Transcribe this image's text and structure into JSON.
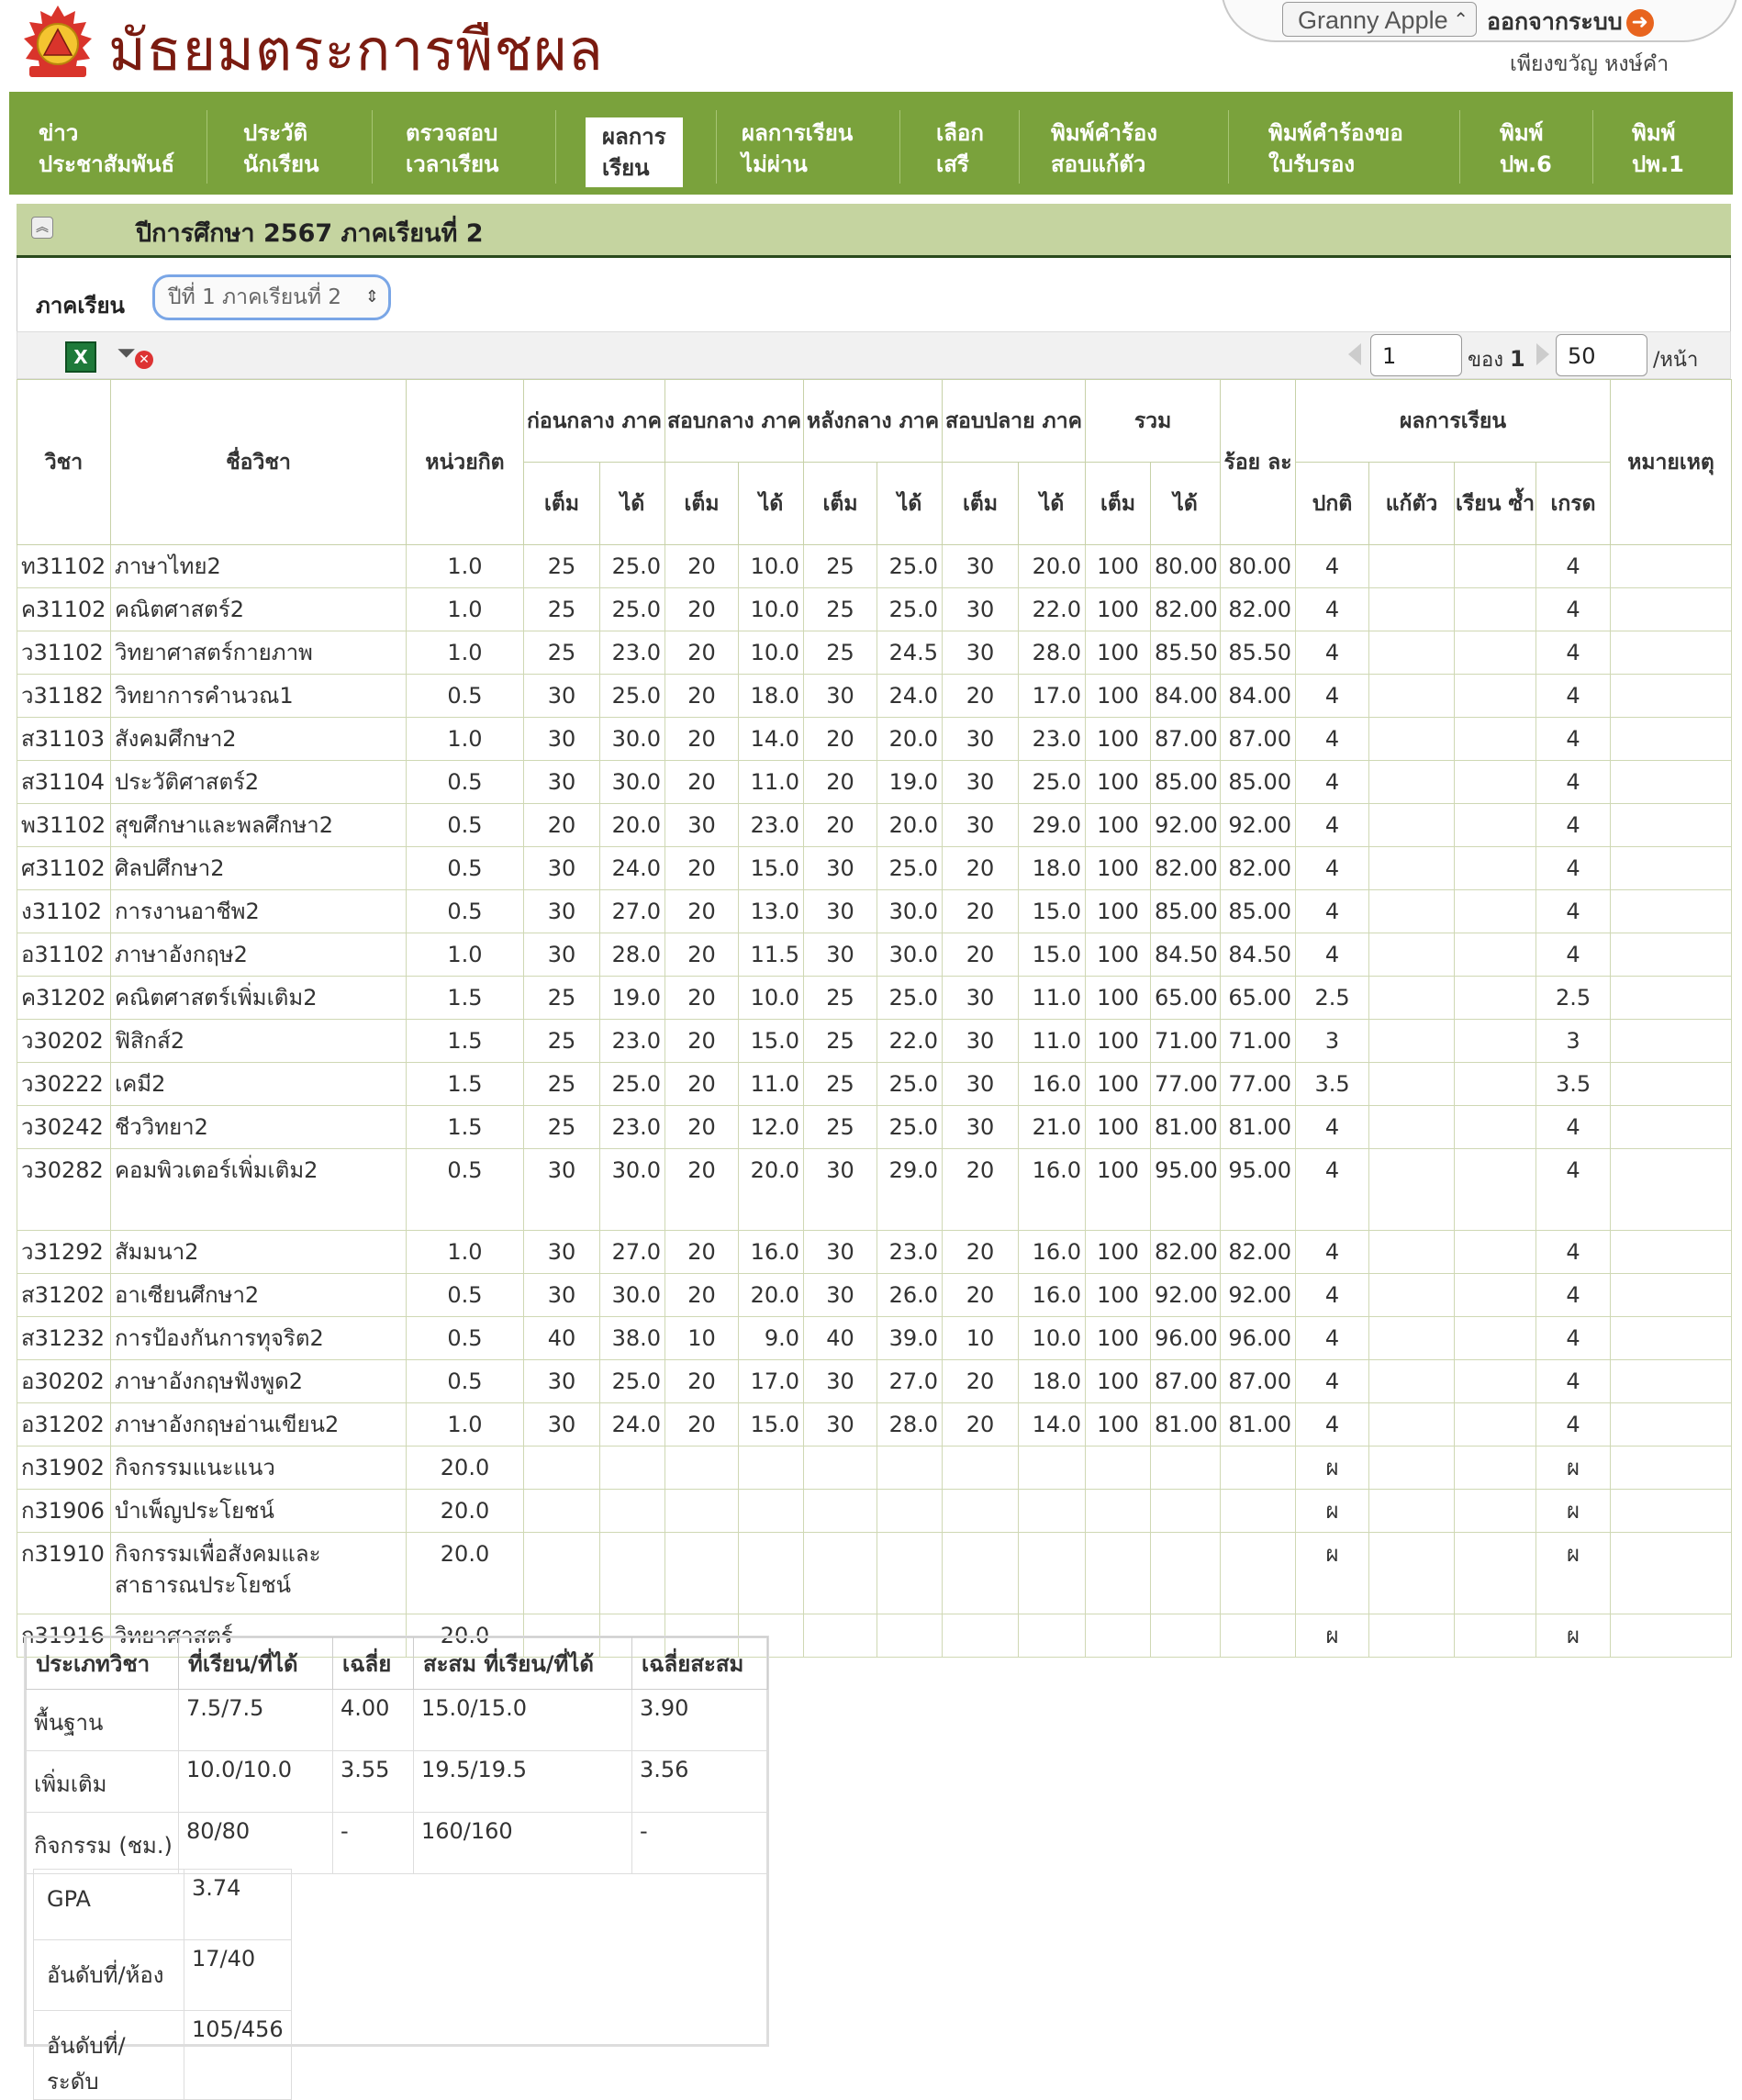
{
  "header": {
    "site_title": "มัธยมตระการพืชผล",
    "user_select": "Granny Apple",
    "logout_label": "ออกจากระบบ",
    "username": "เพียงขวัญ หงษ์คำ"
  },
  "nav": {
    "items": [
      {
        "line1": "ข่าว",
        "line2": "ประชาสัมพันธ์"
      },
      {
        "line1": "ประวัติ",
        "line2": "นักเรียน"
      },
      {
        "line1": "ตรวจสอบ",
        "line2": "เวลาเรียน"
      },
      {
        "line1": "ผลการ",
        "line2": "เรียน"
      },
      {
        "line1": "ผลการเรียน",
        "line2": "ไม่ผ่าน"
      },
      {
        "line1": "เลือก",
        "line2": "เสรี"
      },
      {
        "line1": "พิมพ์คำร้อง",
        "line2": "สอบแก้ตัว"
      },
      {
        "line1": "พิมพ์คำร้องขอ",
        "line2": "ใบรับรอง"
      },
      {
        "line1": "พิมพ์",
        "line2": "ปพ.6"
      },
      {
        "line1": "พิมพ์",
        "line2": "ปพ.1"
      }
    ]
  },
  "section": {
    "title": "ปีการศึกษา 2567 ภาคเรียนที่ 2"
  },
  "filter": {
    "term_label": "ภาคเรียน",
    "term_value": "ปีที่ 1 ภาคเรียนที่ 2"
  },
  "pager": {
    "page": "1",
    "of_label": "ของ",
    "total_pages": "1",
    "per_page": "50",
    "per_page_label": "/หน้า"
  },
  "table": {
    "headers": {
      "code": "วิชา",
      "name": "ชื่อวิชา",
      "credit": "หน่วยกิต",
      "pre_mid": "ก่อนกลาง ภาค",
      "mid": "สอบกลาง ภาค",
      "post_mid": "หลังกลาง ภาค",
      "final": "สอบปลาย ภาค",
      "total": "รวม",
      "percent": "ร้อย ละ",
      "result": "ผลการเรียน",
      "remark": "หมายเหตุ",
      "full": "เต็ม",
      "got": "ได้",
      "normal": "ปกติ",
      "remedial": "แก้ตัว",
      "repeat": "เรียน ซ้ำ",
      "grade": "เกรด"
    },
    "rows": [
      [
        "ท31102",
        "ภาษาไทย2",
        "1.0",
        "25",
        "25.0",
        "20",
        "10.0",
        "25",
        "25.0",
        "30",
        "20.0",
        "100",
        "80.00",
        "80.00",
        "4",
        "",
        "",
        "4"
      ],
      [
        "ค31102",
        "คณิตศาสตร์2",
        "1.0",
        "25",
        "25.0",
        "20",
        "10.0",
        "25",
        "25.0",
        "30",
        "22.0",
        "100",
        "82.00",
        "82.00",
        "4",
        "",
        "",
        "4"
      ],
      [
        "ว31102",
        "วิทยาศาสตร์กายภาพ",
        "1.0",
        "25",
        "23.0",
        "20",
        "10.0",
        "25",
        "24.5",
        "30",
        "28.0",
        "100",
        "85.50",
        "85.50",
        "4",
        "",
        "",
        "4"
      ],
      [
        "ว31182",
        "วิทยาการคำนวณ1",
        "0.5",
        "30",
        "25.0",
        "20",
        "18.0",
        "30",
        "24.0",
        "20",
        "17.0",
        "100",
        "84.00",
        "84.00",
        "4",
        "",
        "",
        "4"
      ],
      [
        "ส31103",
        "สังคมศึกษา2",
        "1.0",
        "30",
        "30.0",
        "20",
        "14.0",
        "20",
        "20.0",
        "30",
        "23.0",
        "100",
        "87.00",
        "87.00",
        "4",
        "",
        "",
        "4"
      ],
      [
        "ส31104",
        "ประวัติศาสตร์2",
        "0.5",
        "30",
        "30.0",
        "20",
        "11.0",
        "20",
        "19.0",
        "30",
        "25.0",
        "100",
        "85.00",
        "85.00",
        "4",
        "",
        "",
        "4"
      ],
      [
        "พ31102",
        "สุขศึกษาและพลศึกษา2",
        "0.5",
        "20",
        "20.0",
        "30",
        "23.0",
        "20",
        "20.0",
        "30",
        "29.0",
        "100",
        "92.00",
        "92.00",
        "4",
        "",
        "",
        "4"
      ],
      [
        "ศ31102",
        "ศิลปศึกษา2",
        "0.5",
        "30",
        "24.0",
        "20",
        "15.0",
        "30",
        "25.0",
        "20",
        "18.0",
        "100",
        "82.00",
        "82.00",
        "4",
        "",
        "",
        "4"
      ],
      [
        "ง31102",
        "การงานอาชีพ2",
        "0.5",
        "30",
        "27.0",
        "20",
        "13.0",
        "30",
        "30.0",
        "20",
        "15.0",
        "100",
        "85.00",
        "85.00",
        "4",
        "",
        "",
        "4"
      ],
      [
        "อ31102",
        "ภาษาอังกฤษ2",
        "1.0",
        "30",
        "28.0",
        "20",
        "11.5",
        "30",
        "30.0",
        "20",
        "15.0",
        "100",
        "84.50",
        "84.50",
        "4",
        "",
        "",
        "4"
      ],
      [
        "ค31202",
        "คณิตศาสตร์เพิ่มเติม2",
        "1.5",
        "25",
        "19.0",
        "20",
        "10.0",
        "25",
        "25.0",
        "30",
        "11.0",
        "100",
        "65.00",
        "65.00",
        "2.5",
        "",
        "",
        "2.5"
      ],
      [
        "ว30202",
        "ฟิสิกส์2",
        "1.5",
        "25",
        "23.0",
        "20",
        "15.0",
        "25",
        "22.0",
        "30",
        "11.0",
        "100",
        "71.00",
        "71.00",
        "3",
        "",
        "",
        "3"
      ],
      [
        "ว30222",
        "เคมี2",
        "1.5",
        "25",
        "25.0",
        "20",
        "11.0",
        "25",
        "25.0",
        "30",
        "16.0",
        "100",
        "77.00",
        "77.00",
        "3.5",
        "",
        "",
        "3.5"
      ],
      [
        "ว30242",
        "ชีววิทยา2",
        "1.5",
        "25",
        "23.0",
        "20",
        "12.0",
        "25",
        "25.0",
        "30",
        "21.0",
        "100",
        "81.00",
        "81.00",
        "4",
        "",
        "",
        "4"
      ],
      [
        "ว30282",
        "คอมพิวเตอร์เพิ่มเติม2",
        "0.5",
        "30",
        "30.0",
        "20",
        "20.0",
        "30",
        "29.0",
        "20",
        "16.0",
        "100",
        "95.00",
        "95.00",
        "4",
        "",
        "",
        "4"
      ],
      [
        "ว31292",
        "สัมมนา2",
        "1.0",
        "30",
        "27.0",
        "20",
        "16.0",
        "30",
        "23.0",
        "20",
        "16.0",
        "100",
        "82.00",
        "82.00",
        "4",
        "",
        "",
        "4"
      ],
      [
        "ส31202",
        "อาเซียนศึกษา2",
        "0.5",
        "30",
        "30.0",
        "20",
        "20.0",
        "30",
        "26.0",
        "20",
        "16.0",
        "100",
        "92.00",
        "92.00",
        "4",
        "",
        "",
        "4"
      ],
      [
        "ส31232",
        "การป้องกันการทุจริต2",
        "0.5",
        "40",
        "38.0",
        "10",
        "9.0",
        "40",
        "39.0",
        "10",
        "10.0",
        "100",
        "96.00",
        "96.00",
        "4",
        "",
        "",
        "4"
      ],
      [
        "อ30202",
        "ภาษาอังกฤษฟังพูด2",
        "0.5",
        "30",
        "25.0",
        "20",
        "17.0",
        "30",
        "27.0",
        "20",
        "18.0",
        "100",
        "87.00",
        "87.00",
        "4",
        "",
        "",
        "4"
      ],
      [
        "อ31202",
        "ภาษาอังกฤษอ่านเขียน2",
        "1.0",
        "30",
        "24.0",
        "20",
        "15.0",
        "30",
        "28.0",
        "20",
        "14.0",
        "100",
        "81.00",
        "81.00",
        "4",
        "",
        "",
        "4"
      ],
      [
        "ก31902",
        "กิจกรรมแนะแนว",
        "20.0",
        "",
        "",
        "",
        "",
        "",
        "",
        "",
        "",
        "",
        "",
        "",
        "ผ",
        "",
        "",
        "ผ"
      ],
      [
        "ก31906",
        "บำเพ็ญประโยชน์",
        "20.0",
        "",
        "",
        "",
        "",
        "",
        "",
        "",
        "",
        "",
        "",
        "",
        "ผ",
        "",
        "",
        "ผ"
      ],
      [
        "ก31910",
        "กิจกรรมเพื่อสังคมและสาธารณประโยชน์",
        "20.0",
        "",
        "",
        "",
        "",
        "",
        "",
        "",
        "",
        "",
        "",
        "",
        "ผ",
        "",
        "",
        "ผ"
      ],
      [
        "ก31916",
        "วิทยาศาสตร์",
        "20.0",
        "",
        "",
        "",
        "",
        "",
        "",
        "",
        "",
        "",
        "",
        "",
        "ผ",
        "",
        "",
        "ผ"
      ]
    ]
  },
  "summary": {
    "headers": [
      "ประเภทวิชา",
      "ที่เรียน/ที่ได้",
      "เฉลี่ย",
      "สะสม ที่เรียน/ที่ได้",
      "เฉลี่ยสะสม"
    ],
    "rows": [
      [
        "พื้นฐาน",
        "7.5/7.5",
        "4.00",
        "15.0/15.0",
        "3.90"
      ],
      [
        "เพิ่มเติม",
        "10.0/10.0",
        "3.55",
        "19.5/19.5",
        "3.56"
      ],
      [
        "กิจกรรม (ชม.)",
        "80/80",
        "-",
        "160/160",
        "-"
      ]
    ],
    "gpa": [
      [
        "GPA",
        "3.74"
      ],
      [
        "อันดับที่/ห้อง",
        "17/40"
      ],
      [
        "อันดับที่/ระดับ",
        "105/456"
      ]
    ]
  },
  "colors": {
    "nav_green": "#7aa23c",
    "section_bar": "#c5d4a0",
    "title_red": "#7a1b10",
    "logout_orange": "#e8641e"
  }
}
